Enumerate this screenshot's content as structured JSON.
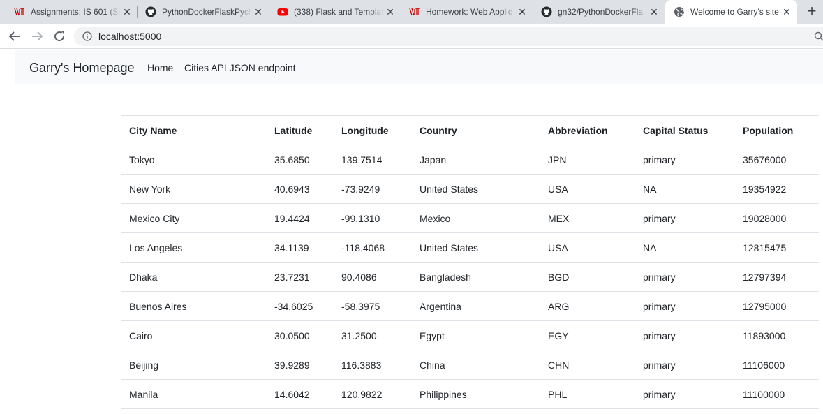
{
  "browser": {
    "tabs": [
      {
        "title": "Assignments: IS 601 (Sp",
        "icon": "njit-icon"
      },
      {
        "title": "PythonDockerFlaskPych",
        "icon": "github-icon"
      },
      {
        "title": "(338) Flask and Templat",
        "icon": "youtube-icon"
      },
      {
        "title": "Homework: Web Applic",
        "icon": "njit-icon"
      },
      {
        "title": "gn32/PythonDockerFla",
        "icon": "github-icon"
      },
      {
        "title": "Welcome to Garry's site",
        "icon": "globe-icon",
        "active": true
      }
    ],
    "new_tab_label": "+",
    "url": "localhost:5000"
  },
  "navbar": {
    "brand": "Garry's Homepage",
    "links": [
      "Home",
      "Cities API JSON endpoint"
    ]
  },
  "table": {
    "columns": [
      "City Name",
      "Latitude",
      "Longitude",
      "Country",
      "Abbreviation",
      "Capital Status",
      "Population"
    ],
    "rows": [
      [
        "Tokyo",
        "35.6850",
        "139.7514",
        "Japan",
        "JPN",
        "primary",
        "35676000"
      ],
      [
        "New York",
        "40.6943",
        "-73.9249",
        "United States",
        "USA",
        "NA",
        "19354922"
      ],
      [
        "Mexico City",
        "19.4424",
        "-99.1310",
        "Mexico",
        "MEX",
        "primary",
        "19028000"
      ],
      [
        "Los Angeles",
        "34.1139",
        "-118.4068",
        "United States",
        "USA",
        "NA",
        "12815475"
      ],
      [
        "Dhaka",
        "23.7231",
        "90.4086",
        "Bangladesh",
        "BGD",
        "primary",
        "12797394"
      ],
      [
        "Buenos Aires",
        "-34.6025",
        "-58.3975",
        "Argentina",
        "ARG",
        "primary",
        "12795000"
      ],
      [
        "Cairo",
        "30.0500",
        "31.2500",
        "Egypt",
        "EGY",
        "primary",
        "11893000"
      ],
      [
        "Beijing",
        "39.9289",
        "116.3883",
        "China",
        "CHN",
        "primary",
        "11106000"
      ],
      [
        "Manila",
        "14.6042",
        "120.9822",
        "Philippines",
        "PHL",
        "primary",
        "11100000"
      ]
    ]
  },
  "colors": {
    "tabstrip": "#dee1e6",
    "navbar_bg": "#f8f9fa",
    "text": "#212529",
    "youtube_red": "#ff0000",
    "njit_red": "#cc0000"
  }
}
